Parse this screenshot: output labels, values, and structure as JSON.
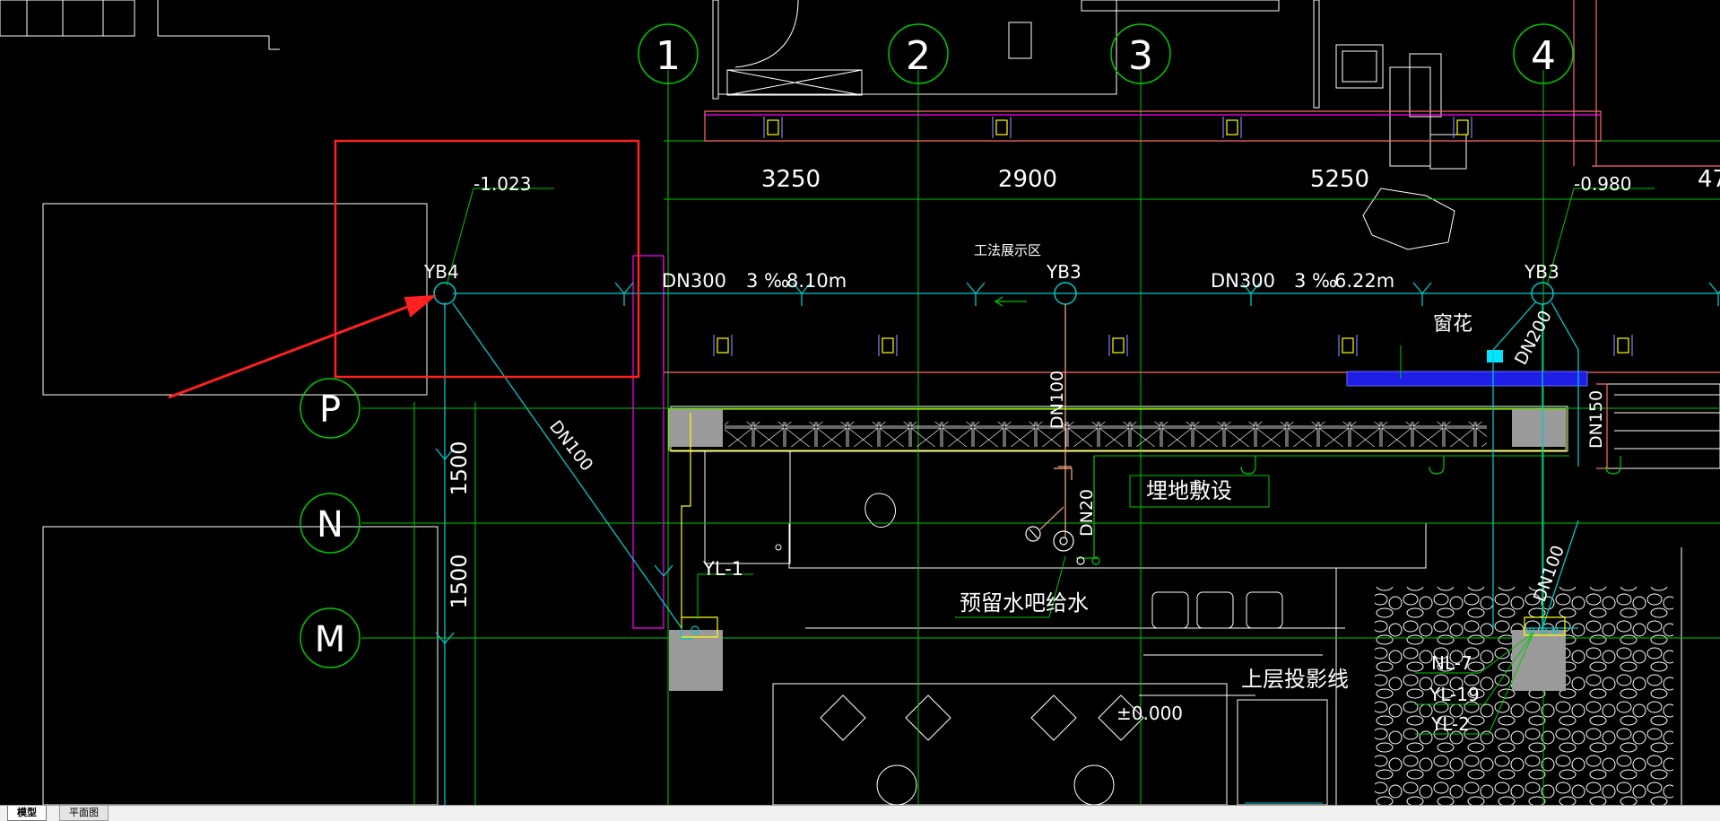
{
  "grid": {
    "axes": [
      "1",
      "2",
      "3",
      "4"
    ],
    "rows": [
      "P",
      "N",
      "M"
    ],
    "spans": [
      "3250",
      "2900",
      "5250",
      "47"
    ],
    "row_spans": [
      "1500",
      "1500"
    ]
  },
  "drain": {
    "yb4": "YB4",
    "yb3_a": "YB3",
    "yb3_b": "YB3",
    "elev_left": "-1.023",
    "elev_right": "-0.980",
    "pipe1_size": "DN300",
    "pipe1_slope": "3 ‰",
    "pipe1_len": "8.10m",
    "pipe2_size": "DN300",
    "pipe2_slope": "3 ‰",
    "pipe2_len": "6.22m",
    "dn100_diag": "DN100",
    "dn100_vert": "DN100",
    "dn200": "DN200",
    "dn150": "DN150",
    "dn100_right": "DN100",
    "dn20": "DN20"
  },
  "labels": {
    "area": "工法展示区",
    "window": "窗花",
    "buried": "埋地敷设",
    "reserve": "预留水吧给水",
    "upper": "上层投影线",
    "elev_zero": "±0.000",
    "yl1": "YL-1",
    "nl7": "NL-7",
    "yl19": "YL-19",
    "yl2": "YL-2"
  },
  "tabs": {
    "model": "模型",
    "plan": "平面图"
  },
  "colors": {
    "background": "#000000",
    "grid": "#00c800",
    "drain": "#00c8c8",
    "annotation": "#ff2020",
    "text": "#ffffff"
  }
}
